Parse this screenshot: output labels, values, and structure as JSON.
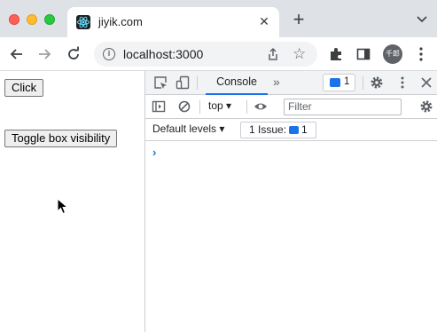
{
  "browser": {
    "tab_title": "jiyik.com",
    "tab_close": "✕",
    "new_tab": "+",
    "url": "localhost:3000",
    "avatar_text": "千郎"
  },
  "page": {
    "click_button": "Click",
    "toggle_button": "Toggle box visibility"
  },
  "devtools": {
    "console_tab": "Console",
    "more_tabs": "»",
    "issue_badge_count": "1",
    "context": "top ▾",
    "filter_placeholder": "Filter",
    "default_levels": "Default levels ▾",
    "issues_label": "1 Issue:",
    "issues_count": "1",
    "prompt": "›"
  },
  "colors": {
    "accent": "#1a73e8",
    "chrome_frame": "#dee1e6",
    "traffic_close": "#ff5f57",
    "traffic_min": "#febc2e",
    "traffic_max": "#28c840"
  }
}
